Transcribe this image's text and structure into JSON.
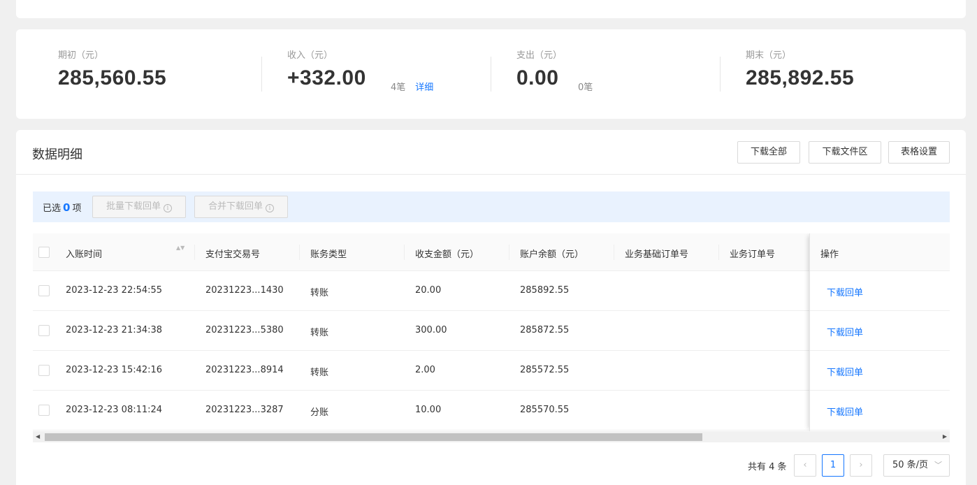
{
  "summary": {
    "opening": {
      "label": "期初（元）",
      "value": "285,560.55"
    },
    "income": {
      "label": "收入（元）",
      "value": "+332.00",
      "count": "4笔",
      "detail_link": "详细"
    },
    "expense": {
      "label": "支出（元）",
      "value": "0.00",
      "count": "0笔"
    },
    "closing": {
      "label": "期末（元）",
      "value": "285,892.55"
    }
  },
  "data_section": {
    "title": "数据明细",
    "buttons": {
      "download_all": "下载全部",
      "download_files": "下载文件区",
      "table_settings": "表格设置"
    }
  },
  "selection": {
    "prefix": "已选",
    "count": "0",
    "suffix": "项",
    "batch_download": "批量下载回单",
    "merge_download": "合并下载回单",
    "info_icon": "i"
  },
  "table": {
    "columns": {
      "time": "入账时间",
      "trade_no": "支付宝交易号",
      "type": "账务类型",
      "amount": "收支金额（元）",
      "balance": "账户余额（元）",
      "base_order": "业务基础订单号",
      "order": "业务订单号",
      "action": "操作"
    },
    "sort_icon": "▲▼",
    "rows": [
      {
        "time": "2023-12-23 22:54:55",
        "trade_no": "20231223...1430",
        "type": "转账",
        "amount": "20.00",
        "balance": "285892.55",
        "action": "下载回单"
      },
      {
        "time": "2023-12-23 21:34:38",
        "trade_no": "20231223...5380",
        "type": "转账",
        "amount": "300.00",
        "balance": "285872.55",
        "action": "下载回单"
      },
      {
        "time": "2023-12-23 15:42:16",
        "trade_no": "20231223...8914",
        "type": "转账",
        "amount": "2.00",
        "balance": "285572.55",
        "action": "下载回单"
      },
      {
        "time": "2023-12-23 08:11:24",
        "trade_no": "20231223...3287",
        "type": "分账",
        "amount": "10.00",
        "balance": "285570.55",
        "action": "下载回单"
      }
    ]
  },
  "scrollbar": {
    "left_arrow": "◀",
    "right_arrow": "▶",
    "position": 0.0
  },
  "pagination": {
    "total": "共有 4 条",
    "prev": "‹",
    "current_page": "1",
    "next": "›",
    "page_size": "50 条/页",
    "dropdown_icon": "﹀"
  }
}
